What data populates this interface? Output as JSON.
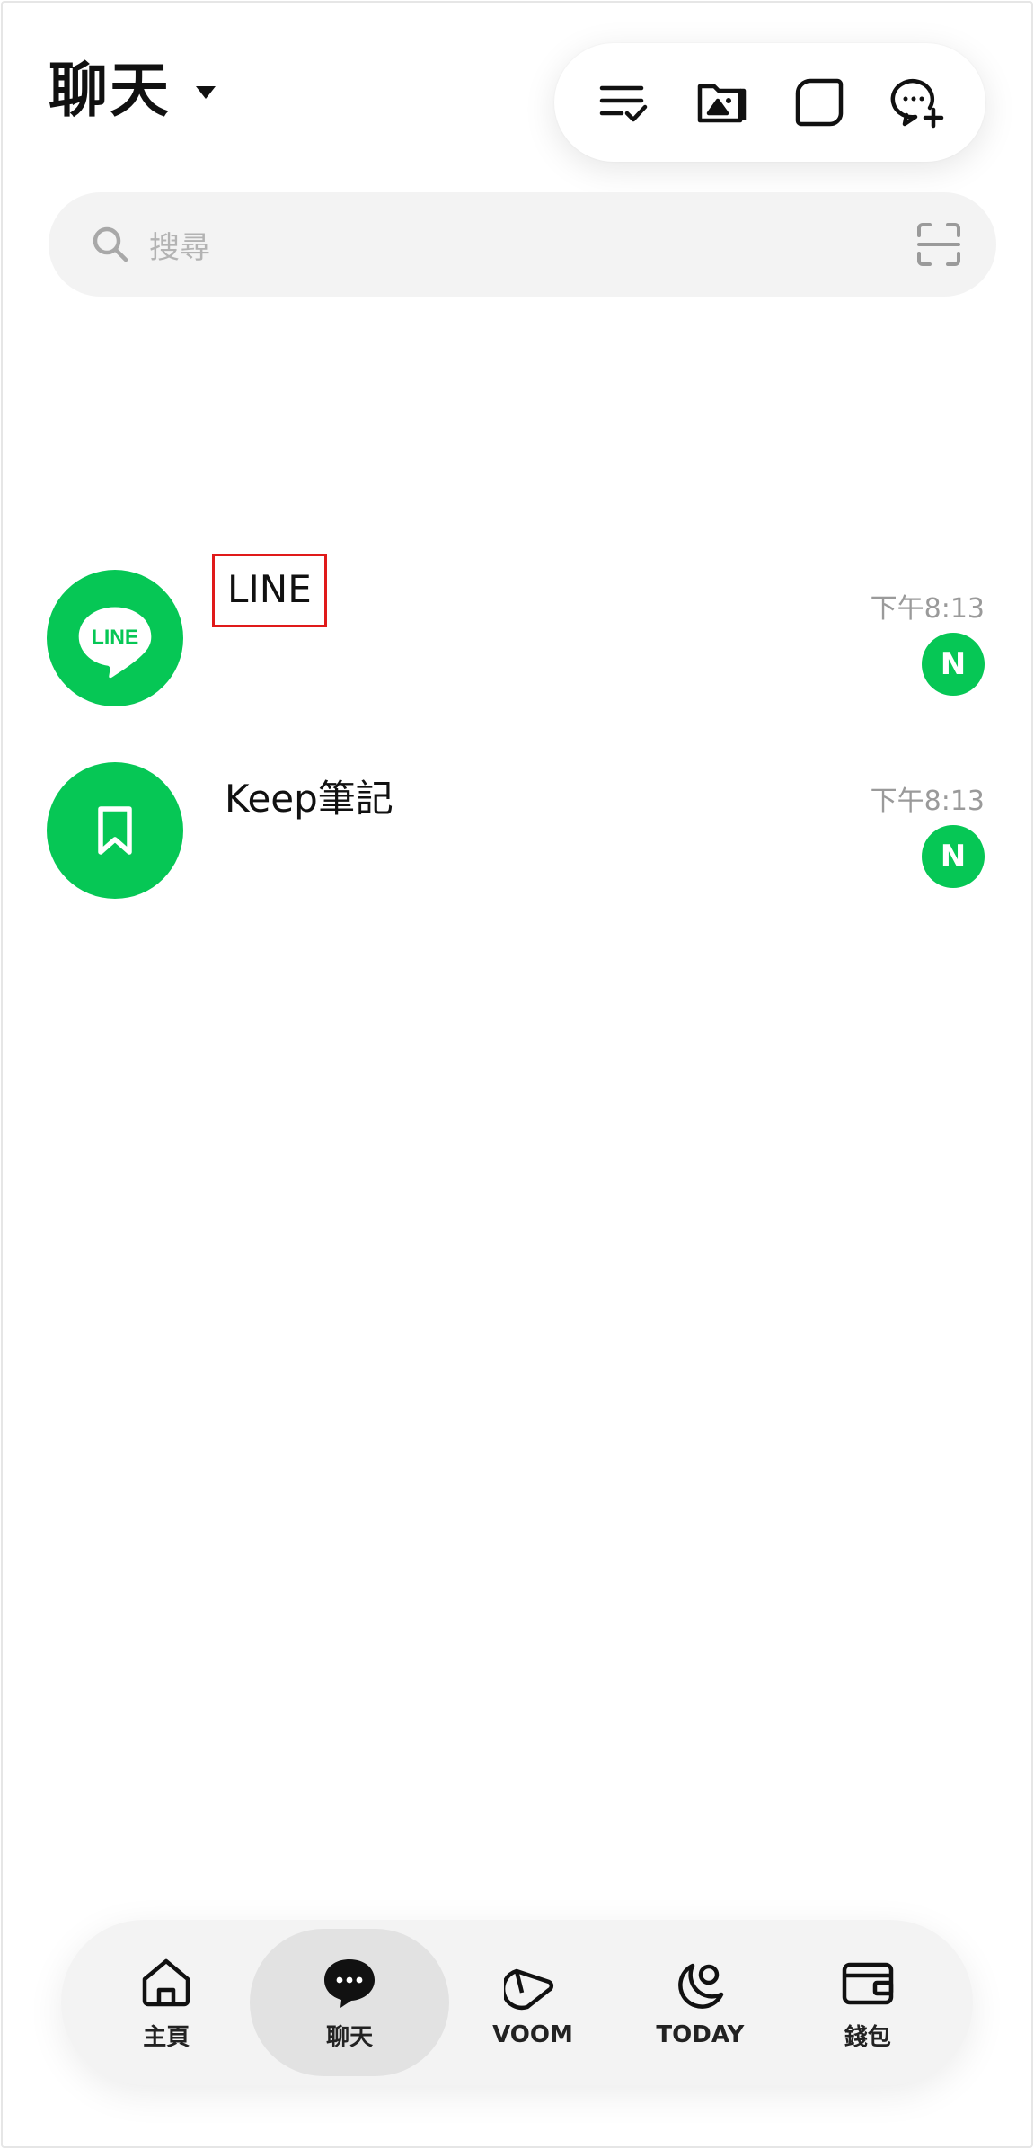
{
  "header": {
    "title": "聊天"
  },
  "search": {
    "placeholder": "搜尋"
  },
  "chats": [
    {
      "name": "LINE",
      "avatar_text": "LINE",
      "time": "下午8:13",
      "badge": "N"
    },
    {
      "name": "Keep筆記",
      "time": "下午8:13",
      "badge": "N"
    }
  ],
  "nav": {
    "items": [
      {
        "label": "主頁",
        "icon": "home-icon"
      },
      {
        "label": "聊天",
        "icon": "chat-icon",
        "active": true
      },
      {
        "label": "VOOM",
        "icon": "voom-icon"
      },
      {
        "label": "TODAY",
        "icon": "today-icon"
      },
      {
        "label": "錢包",
        "icon": "wallet-icon"
      }
    ]
  },
  "colors": {
    "accent": "#06c755",
    "highlight_box": "#e01a1a",
    "search_bg": "#f3f3f3",
    "muted_text": "#9a9a9a"
  }
}
